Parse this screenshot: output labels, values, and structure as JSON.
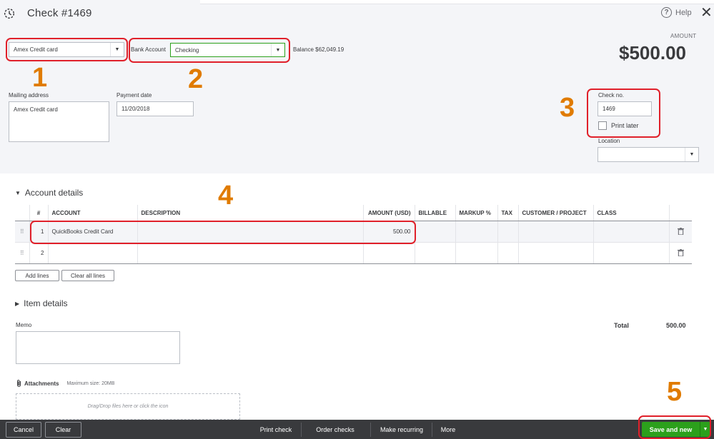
{
  "header": {
    "title": "Check #1469",
    "help_label": "Help",
    "help_glyph": "?",
    "close_glyph": "✕",
    "amount_label": "AMOUNT",
    "amount_value": "$500.00"
  },
  "payee": {
    "value": "Amex Credit card"
  },
  "bank_account": {
    "label": "Bank Account",
    "value": "Checking",
    "balance": "Balance $62,049.19"
  },
  "mailing": {
    "label": "Mailing address",
    "value": "Amex Credit card"
  },
  "payment_date": {
    "label": "Payment date",
    "value": "11/20/2018"
  },
  "check_no": {
    "label": "Check no.",
    "value": "1469",
    "print_later_label": "Print later",
    "print_later_checked": false
  },
  "location": {
    "label": "Location",
    "value": ""
  },
  "annotations": [
    "1",
    "2",
    "3",
    "4",
    "5"
  ],
  "account_details": {
    "title": "Account details",
    "columns": [
      "#",
      "ACCOUNT",
      "DESCRIPTION",
      "AMOUNT (USD)",
      "BILLABLE",
      "MARKUP %",
      "TAX",
      "CUSTOMER / PROJECT",
      "CLASS"
    ],
    "rows": [
      {
        "num": "1",
        "account": "QuickBooks Credit Card",
        "description": "",
        "amount": "500.00"
      },
      {
        "num": "2",
        "account": "",
        "description": "",
        "amount": ""
      }
    ],
    "add_lines": "Add lines",
    "clear_lines": "Clear all lines"
  },
  "item_details": {
    "title": "Item details"
  },
  "memo": {
    "label": "Memo",
    "value": ""
  },
  "total": {
    "label": "Total",
    "value": "500.00"
  },
  "attachments": {
    "label": "Attachments",
    "max_size": "Maximum size: 20MB",
    "drop_hint": "Drag/Drop files here or click the icon"
  },
  "footer": {
    "cancel": "Cancel",
    "clear": "Clear",
    "print_check": "Print check",
    "order_checks": "Order checks",
    "make_recurring": "Make recurring",
    "more": "More",
    "save_and_new": "Save and new"
  },
  "colors": {
    "accent_green": "#2ca01c",
    "annotation_red": "#e0202a",
    "annotation_orange": "#e07b00",
    "footer_bg": "#393a3d"
  }
}
